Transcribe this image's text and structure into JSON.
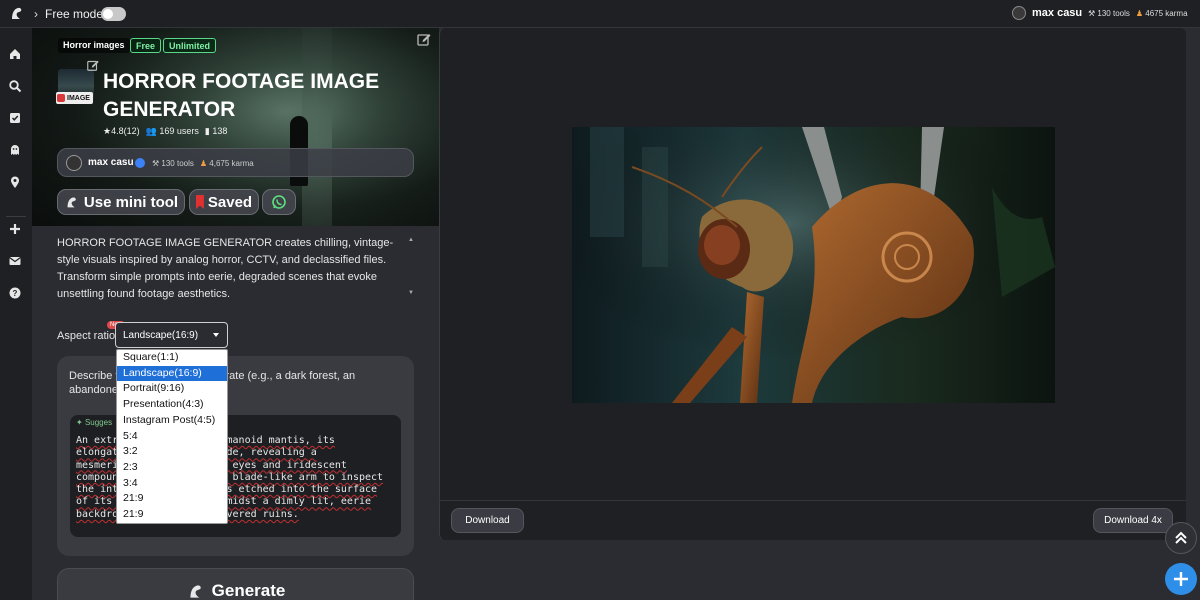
{
  "topbar": {
    "free_mode_label": "Free mode",
    "user_name": "max casu",
    "tools": "130 tools",
    "karma": "4675 karma"
  },
  "sidebar": {
    "items": [
      "home-icon",
      "search-icon",
      "checklist-icon",
      "ghost-icon",
      "location-icon",
      "plus-icon",
      "mail-icon",
      "help-icon"
    ]
  },
  "hero": {
    "category": "Horror images",
    "tag_free": "Free",
    "tag_unlimited": "Unlimited",
    "image_badge": "IMAGE",
    "title": "HORROR FOOTAGE IMAGE GENERATOR",
    "rating": "4.8(12)",
    "users": "169 users",
    "saves": "138",
    "author_name": "max casu",
    "author_tools": "130 tools",
    "author_karma": "4,675 karma",
    "use_mini_tool": "Use mini tool",
    "saved": "Saved"
  },
  "description": "HORROR FOOTAGE IMAGE GENERATOR creates chilling, vintage-style visuals inspired by analog horror, CCTV, and declassified files. Transform simple prompts into eerie, degraded scenes that evoke unsettling found footage aesthetics.",
  "aspect": {
    "label": "Aspect ratio:",
    "new_badge": "New",
    "selected": "Landscape(16:9)",
    "options": [
      "Square(1:1)",
      "Landscape(16:9)",
      "Portrait(9:16)",
      "Presentation(4:3)",
      "Instagram Post(4:5)",
      "5:4",
      "3:2",
      "2:3",
      "3:4",
      "21:9",
      "21:9"
    ]
  },
  "prompt": {
    "help_visible": "Describe t                     t to generate (e.g., a dark forest, an abandone                          tc.)",
    "suggest_label": "Sugges",
    "text_visible": "An extr              a humanoid mantis, its\nelongat              e side, revealing a\nmesmeri              like eyes and iridescent\ncompoun              es a blade-like arm to inspect\nthe int              terns etched into the surface\nof its               m, amidst a dimly lit, eerie\nbackdro              s-covered ruins."
  },
  "generate_label": "Generate",
  "preview": {
    "download": "Download",
    "download_4x": "Download 4x"
  }
}
